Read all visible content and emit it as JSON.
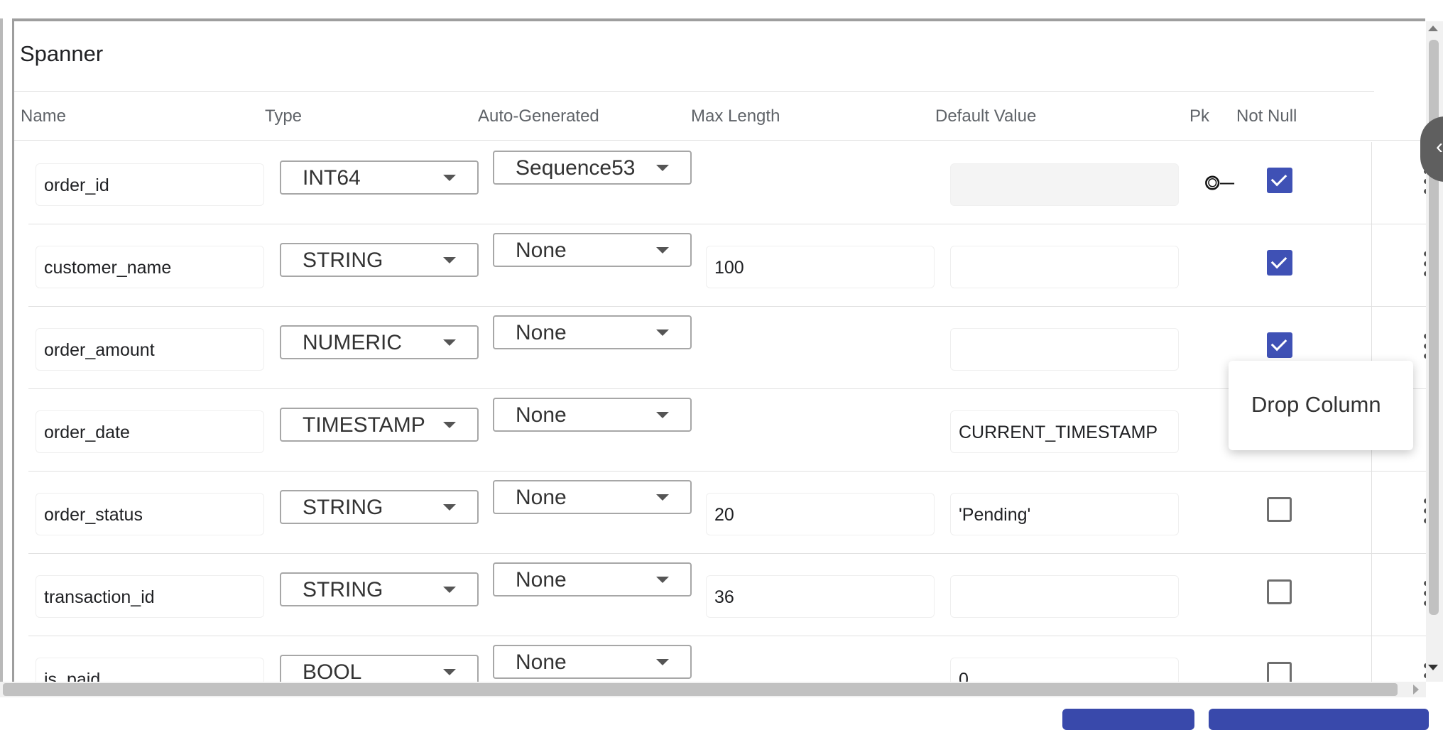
{
  "panel": {
    "title": "Spanner"
  },
  "columns": {
    "name": "Name",
    "type": "Type",
    "auto_generated": "Auto-Generated",
    "max_length": "Max Length",
    "default_value": "Default Value",
    "pk": "Pk",
    "not_null": "Not Null"
  },
  "rows": [
    {
      "name": "order_id",
      "type": "INT64",
      "auto": "Sequence53",
      "max_length": "",
      "default": "",
      "pk": true,
      "not_null": true,
      "default_disabled": true
    },
    {
      "name": "customer_name",
      "type": "STRING",
      "auto": "None",
      "max_length": "100",
      "default": "",
      "pk": false,
      "not_null": true
    },
    {
      "name": "order_amount",
      "type": "NUMERIC",
      "auto": "None",
      "max_length": "",
      "default": "",
      "pk": false,
      "not_null": true
    },
    {
      "name": "order_date",
      "type": "TIMESTAMP",
      "auto": "None",
      "max_length": "",
      "default": "CURRENT_TIMESTAMP",
      "pk": false,
      "not_null": null
    },
    {
      "name": "order_status",
      "type": "STRING",
      "auto": "None",
      "max_length": "20",
      "default": "'Pending'",
      "pk": false,
      "not_null": false
    },
    {
      "name": "transaction_id",
      "type": "STRING",
      "auto": "None",
      "max_length": "36",
      "default": "",
      "pk": false,
      "not_null": false
    },
    {
      "name": "is_paid",
      "type": "BOOL",
      "auto": "None",
      "max_length": "",
      "default": "0",
      "pk": false,
      "not_null": false
    }
  ],
  "context_menu": {
    "drop_column": "Drop Column"
  },
  "icons": {
    "pk": "key-icon",
    "row_menu": "more-vert-icon",
    "collapse": "chevron-left-icon"
  },
  "colors": {
    "accent": "#3f51b5",
    "button": "#3949ab"
  }
}
